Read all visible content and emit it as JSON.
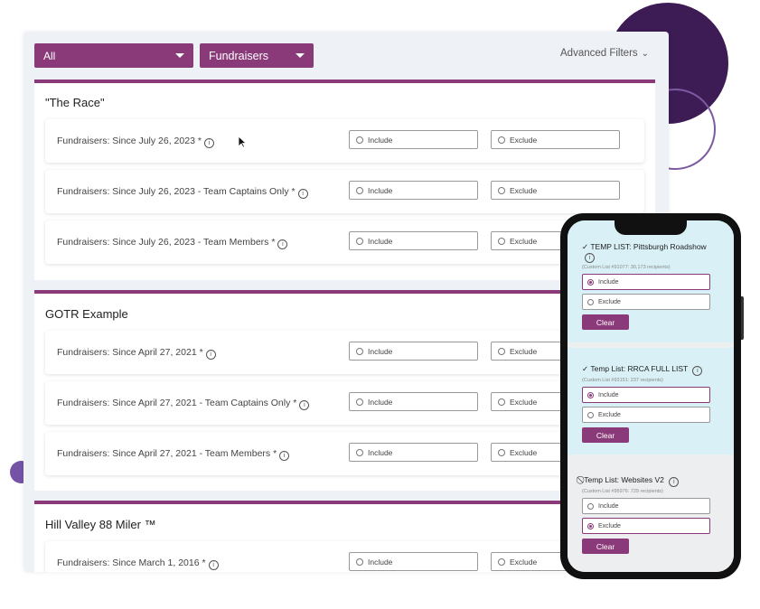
{
  "filters": {
    "status_value": "All",
    "type_value": "Fundraisers",
    "advanced_label": "Advanced Filters"
  },
  "option_labels": {
    "include": "Include",
    "exclude": "Exclude"
  },
  "sections": [
    {
      "title": "\"The Race\"",
      "rows": [
        "Fundraisers: Since July 26, 2023 *",
        "Fundraisers: Since July 26, 2023 - Team Captains Only *",
        "Fundraisers: Since July 26, 2023 - Team Members *"
      ]
    },
    {
      "title": "GOTR Example",
      "rows": [
        "Fundraisers: Since April 27, 2021 *",
        "Fundraisers: Since April 27, 2021 - Team Captains Only *",
        "Fundraisers: Since April 27, 2021 - Team Members *"
      ]
    },
    {
      "title": "Hill Valley 88 Miler ™",
      "rows": [
        "Fundraisers: Since March 1, 2016 *"
      ]
    }
  ],
  "mobile": {
    "clear_label": "Clear",
    "lists": [
      {
        "title": "TEMP LIST: Pittsburgh Roadshow",
        "subtitle": "(Custom List #91077: 30,173 recipients)",
        "state": "include",
        "status_icon": "check-icon"
      },
      {
        "title": "Temp List: RRCA FULL LIST",
        "subtitle": "(Custom List #93151: 237 recipients)",
        "state": "include",
        "status_icon": "check-icon"
      },
      {
        "title": "Temp List: Websites V2",
        "subtitle": "(Custom List #95976: 729 recipients)",
        "state": "exclude",
        "status_icon": "prohibited-icon"
      }
    ]
  },
  "colors": {
    "accent": "#8a3a79",
    "decor_dark": "#3d1b55",
    "decor_dot": "#7452a6",
    "included_bg": "#d9f1f6"
  }
}
